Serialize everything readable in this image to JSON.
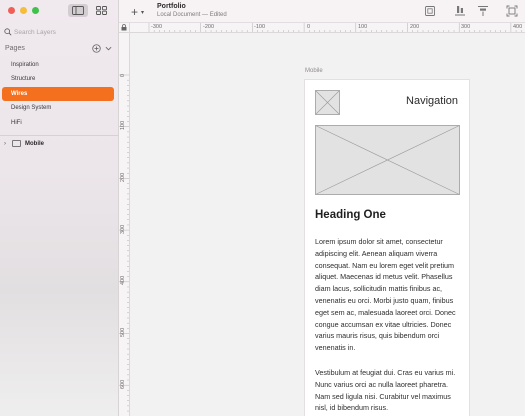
{
  "window": {
    "title": "Portfolio",
    "subtitle": "Local Document — Edited"
  },
  "sidebar": {
    "search_placeholder": "Search Layers",
    "pages_header": "Pages",
    "pages": [
      {
        "label": "Inspiration",
        "selected": false
      },
      {
        "label": "Structure",
        "selected": false
      },
      {
        "label": "Wires",
        "selected": true
      },
      {
        "label": "Design System",
        "selected": false
      },
      {
        "label": "HiFi",
        "selected": false
      }
    ],
    "layers": [
      {
        "label": "Mobile",
        "icon": "device-icon"
      }
    ]
  },
  "rulers": {
    "horizontal": [
      "-300",
      "-200",
      "-100",
      "0",
      "100",
      "200",
      "300",
      "400"
    ],
    "vertical": [
      "0",
      "100",
      "200",
      "300",
      "400",
      "500",
      "600"
    ]
  },
  "artboard": {
    "label": "Mobile",
    "nav_title": "Navigation",
    "heading": "Heading One",
    "paragraph1": "Lorem ipsum dolor sit amet, consectetur adipiscing elit. Aenean aliquam viverra consequat. Nam eu lorem eget velit pretium aliquet. Maecenas id metus velit. Phasellus diam lacus, sollicitudin mattis finibus ac, venenatis eu orci. Morbi justo quam, finibus eget sem ac, malesuada laoreet orci. Donec congue accumsan ex vitae ultricies. Donec varius mauris risus, quis bibendum orci venenatis in.",
    "paragraph2": "Vestibulum at feugiat dui. Cras eu varius mi. Nunc varius orci ac nulla laoreet pharetra. Nam sed ligula nisi. Curabitur vel maximus nisl, id bibendum risus."
  },
  "colors": {
    "accent": "#f46f1e",
    "sidebar_bg": "#ece6ea",
    "canvas_bg": "#f3f2f2"
  }
}
